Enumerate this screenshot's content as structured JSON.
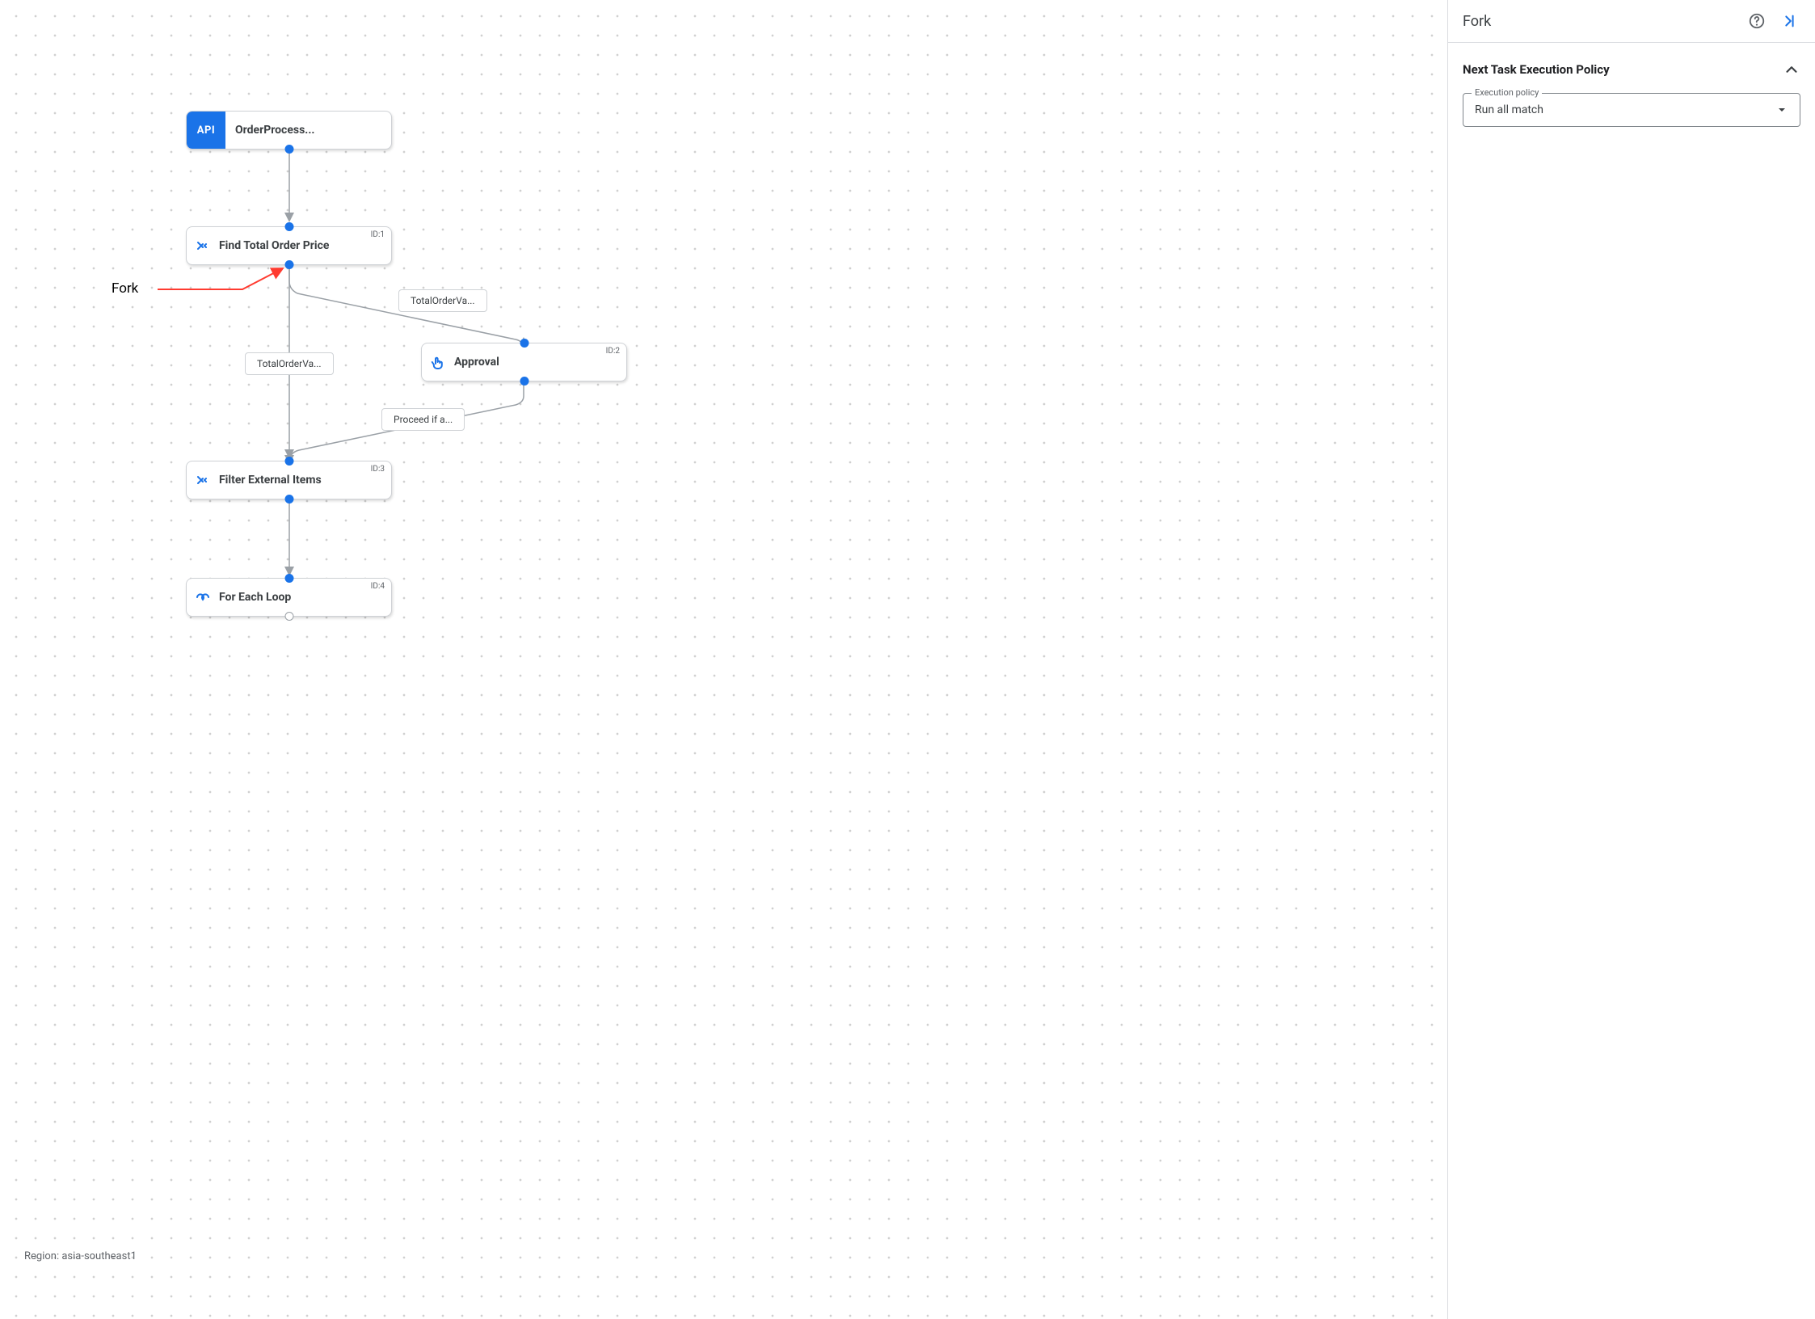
{
  "panel": {
    "title": "Fork",
    "section_title": "Next Task Execution Policy",
    "select_legend": "Execution policy",
    "select_value": "Run all match"
  },
  "region_label": "Region: asia-southeast1",
  "annotation_label": "Fork",
  "nodes": {
    "trigger": {
      "title": "OrderProcess...",
      "icon_text": "API"
    },
    "n1": {
      "title": "Find Total Order Price",
      "id": "ID:1"
    },
    "n2": {
      "title": "Approval",
      "id": "ID:2"
    },
    "n3": {
      "title": "Filter External Items",
      "id": "ID:3"
    },
    "n4": {
      "title": "For Each Loop",
      "id": "ID:4"
    }
  },
  "edges": {
    "e_total_left": "TotalOrderVa...",
    "e_total_right": "TotalOrderVa...",
    "e_proceed": "Proceed if a..."
  }
}
